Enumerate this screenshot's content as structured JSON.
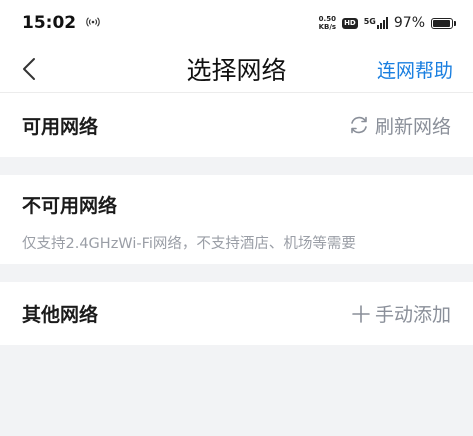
{
  "status_bar": {
    "time": "15:02",
    "hotspot_icon": "hotspot-icon",
    "net_speed_value": "0.50",
    "net_speed_unit": "KB/s",
    "hd_badge": "HD",
    "network_type": "5G",
    "battery_percent": "97%",
    "battery_level": 0.97
  },
  "navbar": {
    "back_icon": "chevron-left-icon",
    "title": "选择网络",
    "help_label": "连网帮助"
  },
  "available": {
    "title": "可用网络",
    "refresh_icon": "refresh-icon",
    "refresh_label": "刷新网络"
  },
  "unavailable": {
    "title": "不可用网络",
    "description": "仅支持2.4GHzWi-Fi网络，不支持酒店、机场等需要"
  },
  "other": {
    "title": "其他网络",
    "add_icon": "plus-icon",
    "add_label": "手动添加"
  },
  "colors": {
    "accent": "#1a7fe0",
    "page_background": "#f2f3f5",
    "secondary_text": "#8a8f99"
  }
}
